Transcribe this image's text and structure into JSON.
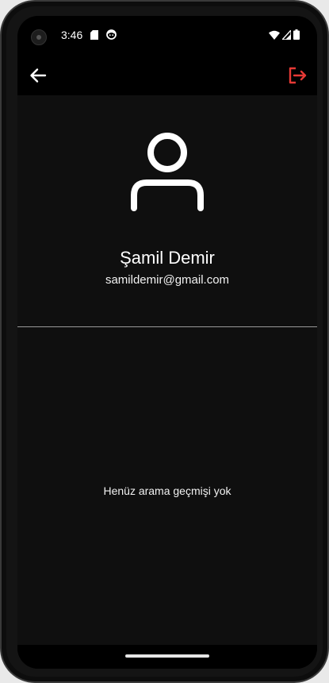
{
  "status_bar": {
    "time": "3:46",
    "icons": [
      "sd-card-icon",
      "face-icon",
      "wifi-icon",
      "signal-icon",
      "battery-icon"
    ]
  },
  "app_bar": {
    "back_icon": "arrow-left-icon",
    "logout_icon": "logout-icon",
    "logout_color": "#e53935"
  },
  "profile": {
    "avatar_icon": "person-icon",
    "name": "Şamil Demir",
    "email": "samildemir@gmail.com"
  },
  "history": {
    "empty_message": "Henüz arama geçmişi yok"
  }
}
